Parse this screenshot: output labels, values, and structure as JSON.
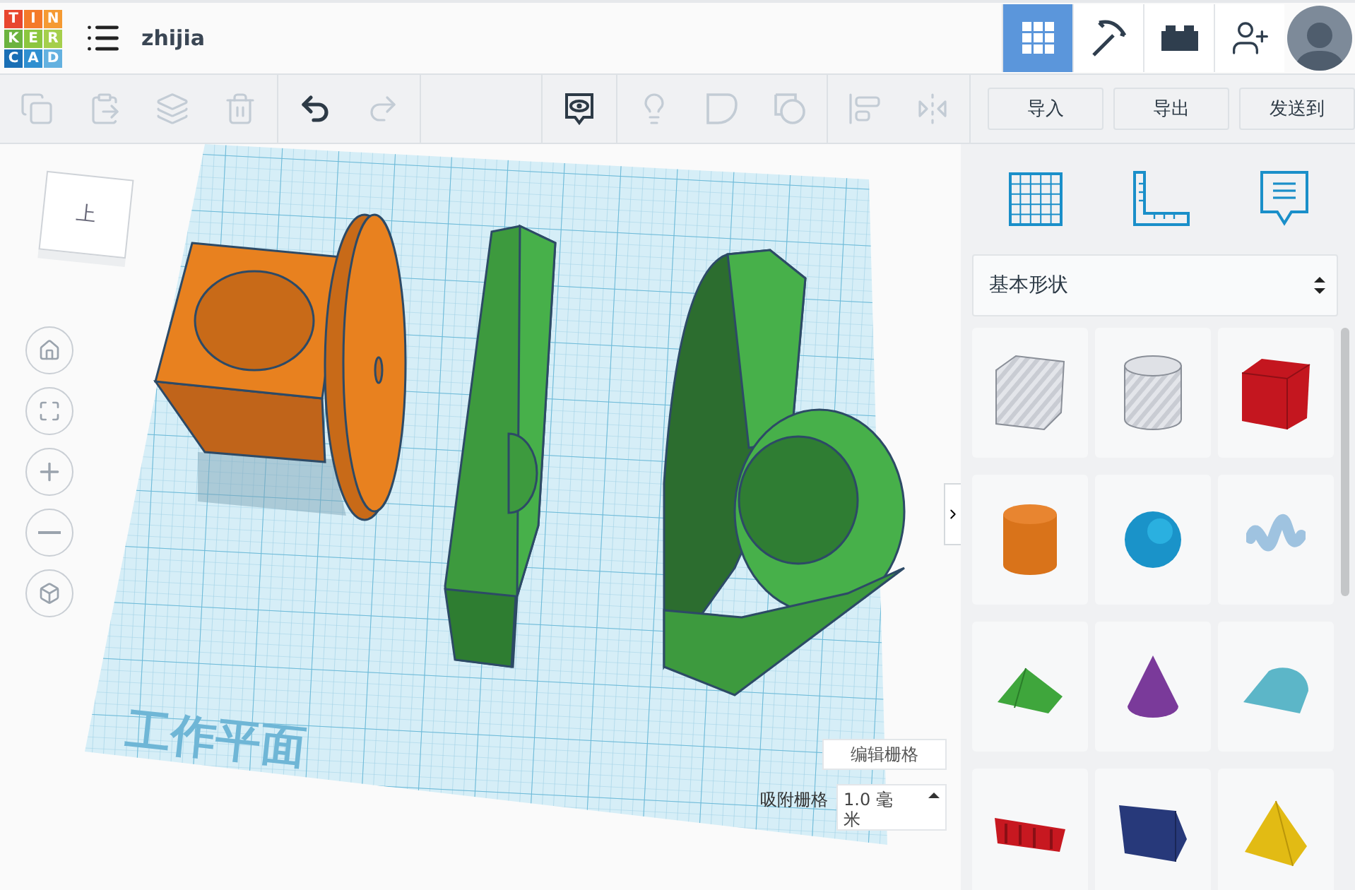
{
  "header": {
    "logo": [
      {
        "letter": "T",
        "color": "#e8462f"
      },
      {
        "letter": "I",
        "color": "#f47a2a"
      },
      {
        "letter": "N",
        "color": "#f59a32"
      },
      {
        "letter": "K",
        "color": "#6cb33f"
      },
      {
        "letter": "E",
        "color": "#8cc63f"
      },
      {
        "letter": "R",
        "color": "#a5cf4c"
      },
      {
        "letter": "C",
        "color": "#1a6fb5"
      },
      {
        "letter": "A",
        "color": "#2f8fd0"
      },
      {
        "letter": "D",
        "color": "#63b1e0"
      }
    ],
    "project_name": "zhijia",
    "view_tabs": [
      {
        "kind": "grid",
        "selected": true
      },
      {
        "kind": "pickaxe",
        "selected": false
      },
      {
        "kind": "brick",
        "selected": false
      },
      {
        "kind": "add-user",
        "selected": false
      }
    ]
  },
  "toolbar": {
    "groups": [
      [
        {
          "kind": "copy",
          "disabled": true
        },
        {
          "kind": "paste",
          "disabled": true
        },
        {
          "kind": "duplicate",
          "disabled": true
        },
        {
          "kind": "delete",
          "disabled": true
        }
      ],
      [
        {
          "kind": "undo",
          "disabled": false
        },
        {
          "kind": "redo",
          "disabled": true
        }
      ],
      [
        {
          "kind": "notes",
          "disabled": false
        }
      ],
      [
        {
          "kind": "hint",
          "disabled": true
        },
        {
          "kind": "solid",
          "disabled": true
        },
        {
          "kind": "hole",
          "disabled": true
        }
      ],
      [
        {
          "kind": "align",
          "disabled": true
        },
        {
          "kind": "mirror",
          "disabled": true
        }
      ]
    ],
    "buttons": [
      "导入",
      "导出",
      "发送到"
    ]
  },
  "viewport": {
    "view_cube_label": "上",
    "workplane_label": "工作平面",
    "edit_grid": "编辑栅格",
    "snap_grid_label": "吸附栅格",
    "snap_grid_value": "1.0 毫米"
  },
  "panel": {
    "tools": [
      {
        "kind": "workplane"
      },
      {
        "kind": "ruler"
      },
      {
        "kind": "notes"
      }
    ],
    "library": "基本形状",
    "shapes": [
      {
        "kind": "box-hole"
      },
      {
        "kind": "cylinder-hole"
      },
      {
        "kind": "box"
      },
      {
        "kind": "cylinder"
      },
      {
        "kind": "sphere"
      },
      {
        "kind": "scribble"
      },
      {
        "kind": "roof"
      },
      {
        "kind": "cone"
      },
      {
        "kind": "round-roof"
      },
      {
        "kind": "text"
      },
      {
        "kind": "prism"
      },
      {
        "kind": "pyramid"
      }
    ]
  }
}
